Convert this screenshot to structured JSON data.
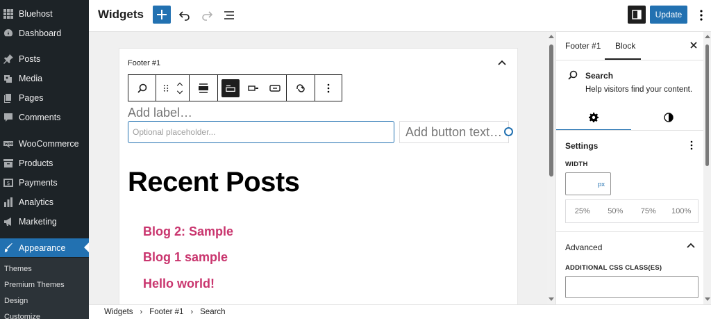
{
  "admin_menu": {
    "items": [
      {
        "label": "Bluehost",
        "icon": "grid-icon"
      },
      {
        "label": "Dashboard",
        "icon": "dashboard-icon"
      },
      {
        "label": "Posts",
        "icon": "pin-icon"
      },
      {
        "label": "Media",
        "icon": "media-icon"
      },
      {
        "label": "Pages",
        "icon": "pages-icon"
      },
      {
        "label": "Comments",
        "icon": "comment-icon"
      },
      {
        "label": "WooCommerce",
        "icon": "woocommerce-icon"
      },
      {
        "label": "Products",
        "icon": "archive-icon"
      },
      {
        "label": "Payments",
        "icon": "dollar-icon"
      },
      {
        "label": "Analytics",
        "icon": "chart-bar-icon"
      },
      {
        "label": "Marketing",
        "icon": "megaphone-icon"
      },
      {
        "label": "Appearance",
        "icon": "brush-icon",
        "active": true
      }
    ],
    "submenu": [
      "Themes",
      "Premium Themes",
      "Design",
      "Customize"
    ]
  },
  "toolbar": {
    "title": "Widgets",
    "update_label": "Update"
  },
  "widget_area": {
    "title": "Footer #1",
    "search_label_placeholder": "Add label…",
    "search_input_placeholder": "Optional placeholder...",
    "button_text_placeholder": "Add button text…",
    "recent_posts_heading": "Recent Posts",
    "posts": [
      "Blog 2: Sample",
      "Blog 1 sample",
      "Hello world!"
    ]
  },
  "inspector": {
    "tabs": [
      "Footer #1",
      "Block"
    ],
    "active_tab": "Block",
    "block_name": "Search",
    "block_description": "Help visitors find your content.",
    "settings_title": "Settings",
    "width_label": "WIDTH",
    "width_unit": "px",
    "width_presets": [
      "25%",
      "50%",
      "75%",
      "100%"
    ],
    "advanced_title": "Advanced",
    "css_class_label": "ADDITIONAL CSS CLASS(ES)"
  },
  "breadcrumb": [
    "Widgets",
    "Footer #1",
    "Search"
  ],
  "colors": {
    "admin_bg": "#1d2327",
    "accent": "#2271b1",
    "post_link": "#c9356e"
  }
}
